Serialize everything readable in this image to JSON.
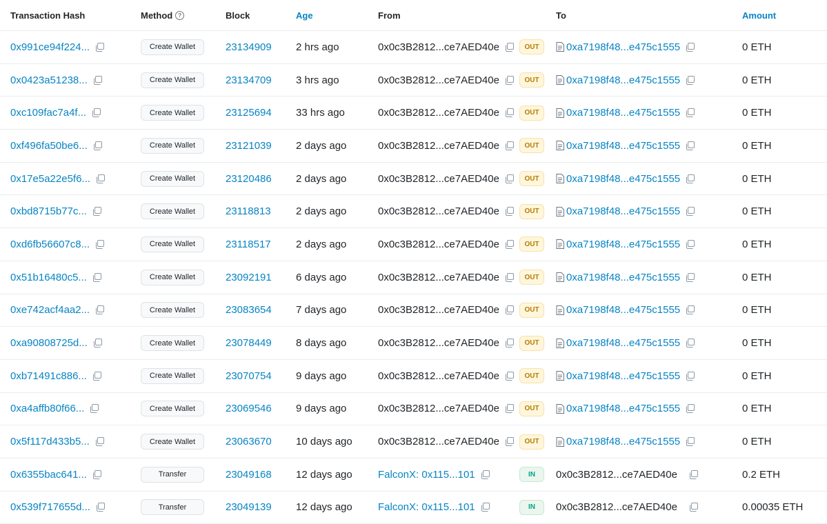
{
  "headers": {
    "hash": "Transaction Hash",
    "method": "Method",
    "block": "Block",
    "age": "Age",
    "from": "From",
    "to": "To",
    "amount": "Amount"
  },
  "colors": {
    "link": "#0784c3",
    "out_bg": "#fff6dd",
    "in_bg": "#eaf6ee"
  },
  "rows": [
    {
      "hash": "0x991ce94f224...",
      "method": "Create Wallet",
      "block": "23134909",
      "age": "2 hrs ago",
      "from": "0x0c3B2812...ce7AED40e",
      "from_link": false,
      "dir": "OUT",
      "to": "0xa7198f48...e475c1555",
      "to_link": true,
      "amount": "0 ETH"
    },
    {
      "hash": "0x0423a51238...",
      "method": "Create Wallet",
      "block": "23134709",
      "age": "3 hrs ago",
      "from": "0x0c3B2812...ce7AED40e",
      "from_link": false,
      "dir": "OUT",
      "to": "0xa7198f48...e475c1555",
      "to_link": true,
      "amount": "0 ETH"
    },
    {
      "hash": "0xc109fac7a4f...",
      "method": "Create Wallet",
      "block": "23125694",
      "age": "33 hrs ago",
      "from": "0x0c3B2812...ce7AED40e",
      "from_link": false,
      "dir": "OUT",
      "to": "0xa7198f48...e475c1555",
      "to_link": true,
      "amount": "0 ETH"
    },
    {
      "hash": "0xf496fa50be6...",
      "method": "Create Wallet",
      "block": "23121039",
      "age": "2 days ago",
      "from": "0x0c3B2812...ce7AED40e",
      "from_link": false,
      "dir": "OUT",
      "to": "0xa7198f48...e475c1555",
      "to_link": true,
      "amount": "0 ETH"
    },
    {
      "hash": "0x17e5a22e5f6...",
      "method": "Create Wallet",
      "block": "23120486",
      "age": "2 days ago",
      "from": "0x0c3B2812...ce7AED40e",
      "from_link": false,
      "dir": "OUT",
      "to": "0xa7198f48...e475c1555",
      "to_link": true,
      "amount": "0 ETH"
    },
    {
      "hash": "0xbd8715b77c...",
      "method": "Create Wallet",
      "block": "23118813",
      "age": "2 days ago",
      "from": "0x0c3B2812...ce7AED40e",
      "from_link": false,
      "dir": "OUT",
      "to": "0xa7198f48...e475c1555",
      "to_link": true,
      "amount": "0 ETH"
    },
    {
      "hash": "0xd6fb56607c8...",
      "method": "Create Wallet",
      "block": "23118517",
      "age": "2 days ago",
      "from": "0x0c3B2812...ce7AED40e",
      "from_link": false,
      "dir": "OUT",
      "to": "0xa7198f48...e475c1555",
      "to_link": true,
      "amount": "0 ETH"
    },
    {
      "hash": "0x51b16480c5...",
      "method": "Create Wallet",
      "block": "23092191",
      "age": "6 days ago",
      "from": "0x0c3B2812...ce7AED40e",
      "from_link": false,
      "dir": "OUT",
      "to": "0xa7198f48...e475c1555",
      "to_link": true,
      "amount": "0 ETH"
    },
    {
      "hash": "0xe742acf4aa2...",
      "method": "Create Wallet",
      "block": "23083654",
      "age": "7 days ago",
      "from": "0x0c3B2812...ce7AED40e",
      "from_link": false,
      "dir": "OUT",
      "to": "0xa7198f48...e475c1555",
      "to_link": true,
      "amount": "0 ETH"
    },
    {
      "hash": "0xa90808725d...",
      "method": "Create Wallet",
      "block": "23078449",
      "age": "8 days ago",
      "from": "0x0c3B2812...ce7AED40e",
      "from_link": false,
      "dir": "OUT",
      "to": "0xa7198f48...e475c1555",
      "to_link": true,
      "amount": "0 ETH"
    },
    {
      "hash": "0xb71491c886...",
      "method": "Create Wallet",
      "block": "23070754",
      "age": "9 days ago",
      "from": "0x0c3B2812...ce7AED40e",
      "from_link": false,
      "dir": "OUT",
      "to": "0xa7198f48...e475c1555",
      "to_link": true,
      "amount": "0 ETH"
    },
    {
      "hash": "0xa4affb80f66...",
      "method": "Create Wallet",
      "block": "23069546",
      "age": "9 days ago",
      "from": "0x0c3B2812...ce7AED40e",
      "from_link": false,
      "dir": "OUT",
      "to": "0xa7198f48...e475c1555",
      "to_link": true,
      "amount": "0 ETH"
    },
    {
      "hash": "0x5f117d433b5...",
      "method": "Create Wallet",
      "block": "23063670",
      "age": "10 days ago",
      "from": "0x0c3B2812...ce7AED40e",
      "from_link": false,
      "dir": "OUT",
      "to": "0xa7198f48...e475c1555",
      "to_link": true,
      "amount": "0 ETH"
    },
    {
      "hash": "0x6355bac641...",
      "method": "Transfer",
      "block": "23049168",
      "age": "12 days ago",
      "from": "FalconX: 0x115...101",
      "from_link": true,
      "dir": "IN",
      "to": "0x0c3B2812...ce7AED40e",
      "to_link": false,
      "amount": "0.2 ETH"
    },
    {
      "hash": "0x539f717655d...",
      "method": "Transfer",
      "block": "23049139",
      "age": "12 days ago",
      "from": "FalconX: 0x115...101",
      "from_link": true,
      "dir": "IN",
      "to": "0x0c3B2812...ce7AED40e",
      "to_link": false,
      "amount": "0.00035 ETH"
    }
  ]
}
